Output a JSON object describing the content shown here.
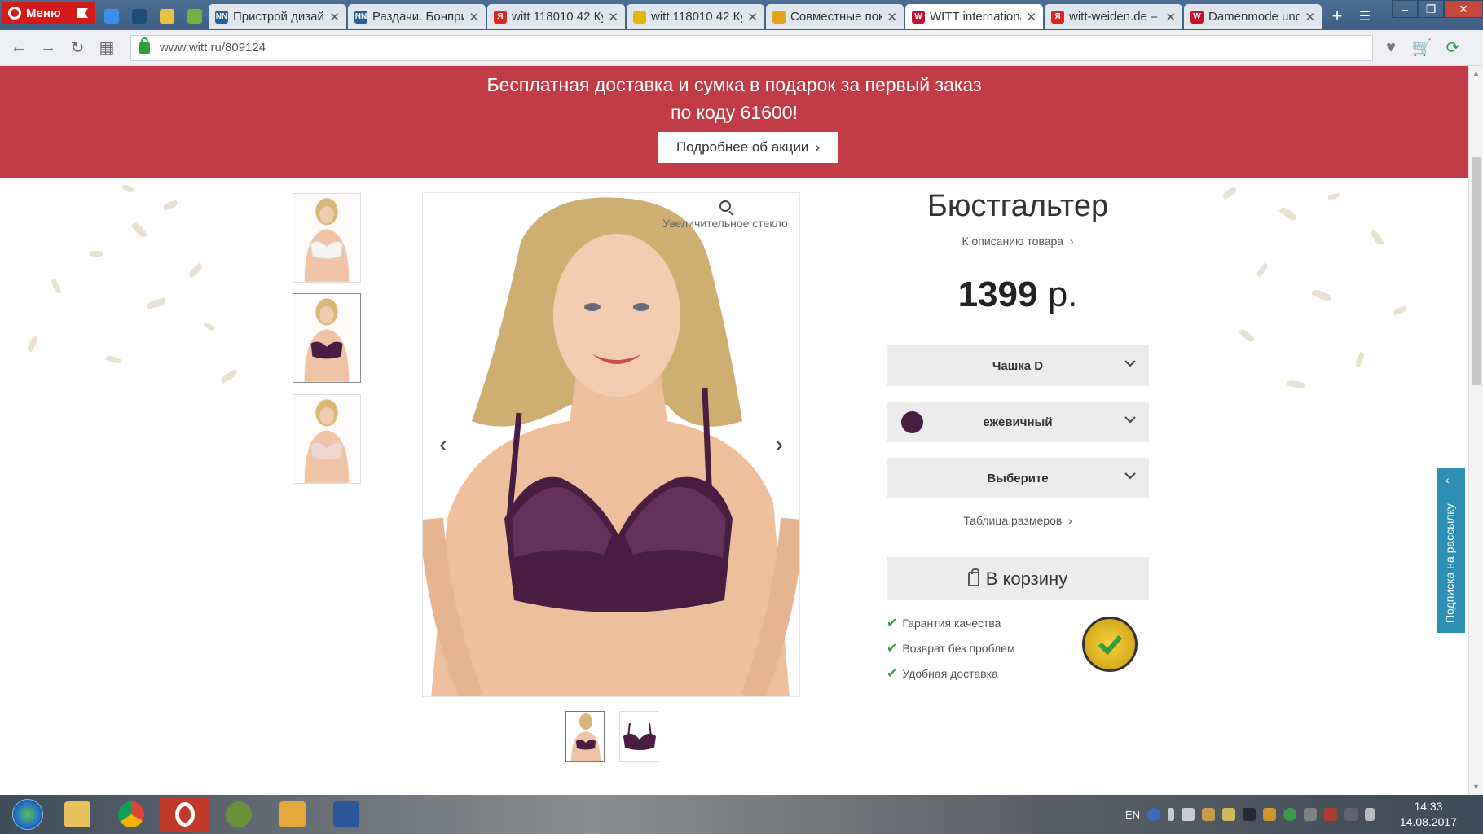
{
  "browser": {
    "menu_label": "Меню",
    "tabs": [
      {
        "title": "Пристрой дизай",
        "fav": "#2a6099",
        "fav_text": "NN",
        "active": false
      },
      {
        "title": "Раздачи. Бонпри",
        "fav": "#2a6099",
        "fav_text": "NN",
        "active": false
      },
      {
        "title": "witt 118010 42 Ку",
        "fav": "#e0261e",
        "fav_text": "Я",
        "active": false
      },
      {
        "title": "witt 118010 42 Ку",
        "fav": "#e8b400",
        "fav_text": "",
        "active": false
      },
      {
        "title": "Совместные пок",
        "fav": "#e3a418",
        "fav_text": "",
        "active": false
      },
      {
        "title": "WITT internationa",
        "fav": "#c8102e",
        "fav_text": "W",
        "active": true
      },
      {
        "title": "witt-weiden.de –",
        "fav": "#e0261e",
        "fav_text": "Я",
        "active": false
      },
      {
        "title": "Damenmode und",
        "fav": "#c8102e",
        "fav_text": "W",
        "active": false
      }
    ],
    "url": "www.witt.ru/809124"
  },
  "promo": {
    "line1": "Бесплатная доставка и сумка в подарок за первый заказ",
    "line2": "по коду 61600!",
    "button_label": "Подробнее об акции"
  },
  "product": {
    "zoom_label": "Увеличительное стекло",
    "title": "Бюстгальтер",
    "description_link": "К описанию товара",
    "price_number": "1399",
    "price_currency": "р.",
    "cup_select": "Чашка D",
    "color_select": "ежевичный",
    "color_swatch": "#4a1d42",
    "size_select": "Выберите",
    "size_table_link": "Таблица размеров",
    "cart_button": "В корзину",
    "features": [
      "Гарантия качества",
      "Возврат без проблем",
      "Удобная доставка"
    ]
  },
  "newsletter": {
    "label": "Подписка на рассылку"
  },
  "taskbar": {
    "lang": "EN",
    "time": "14:33",
    "date": "14.08.2017"
  },
  "colors": {
    "promo_bg": "#c23c48",
    "newsletter_bg": "#2e8fb5",
    "bra_color": "#4a1d42"
  }
}
